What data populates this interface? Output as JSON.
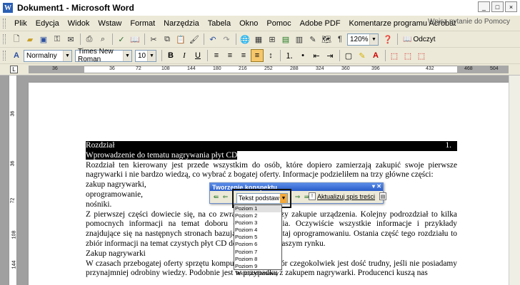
{
  "window": {
    "title": "Dokument1 - Microsoft Word",
    "app_icon": "W",
    "minimize": "_",
    "maximize": "□",
    "close": "×"
  },
  "menu": {
    "items": [
      "Plik",
      "Edycja",
      "Widok",
      "Wstaw",
      "Format",
      "Narzędzia",
      "Tabela",
      "Okno",
      "Pomoc",
      "Adobe PDF",
      "Komentarze programu Acrobat"
    ],
    "help_placeholder": "Wpisz pytanie do Pomocy"
  },
  "standard_toolbar": {
    "zoom": "120%",
    "read_button": "Odczyt"
  },
  "formatting_toolbar": {
    "style": "Normalny",
    "font": "Times New Roman",
    "size": "10",
    "bold": "B",
    "italic": "I",
    "underline": "U"
  },
  "ruler": {
    "tab_selector": "L",
    "h_numbers": [
      "36",
      "36",
      "72",
      "108",
      "144",
      "180",
      "216",
      "252",
      "288",
      "324",
      "360",
      "396",
      "432",
      "468",
      "504"
    ],
    "v_numbers": [
      "36",
      "36",
      "72",
      "108",
      "144"
    ]
  },
  "document": {
    "heading1": "Rozdział",
    "heading1_num": "1.",
    "heading2": "Wprowadzenie do tematu nagrywania płyt CD",
    "para1": "Rozdział ten kierowany jest przede wszystkim do osób, które dopiero zamierzają zakupić swoje pierwsze nagrywarki i nie bardzo wiedzą, co wybrać z bogatej oferty. Informacje podzieliłem na trzy główne części:",
    "list1": "zakup nagrywarki,",
    "list2": "oprogramowanie,",
    "list3": "nośniki.",
    "para2": "Z pierwszej części dowiecie się, na co zwracać uwagę przy zakupie urządzenia. Kolejny podrozdział to kilka pomocnych informacji na temat doboru oprogramowania. Oczywiście wszystkie informacje i przykłady znajdujące się na następnych stronach bazują właśnie na tutaj oprogramowaniu. Ostania część tego rozdziału to zbiór informacji na temat czystych płyt CD dostępnych na naszym rynku.",
    "heading3": "Zakup nagrywarki",
    "para3": "W czasach przebogatej oferty sprzętu komputerowego wybór czegokolwiek jest dość trudny, jeśli nie posiadamy przynajmniej odrobiny wiedzy. Podobnie jest w przypadku z zakupem nagrywarki. Producenci kuszą nas"
  },
  "outline_toolbar": {
    "title": "Tworzenie konspektu",
    "level_value": "Tekst podstaw",
    "update_toc": "Aktualizuj spis treści",
    "levels": [
      "Poziom 1",
      "Poziom 2",
      "Poziom 3",
      "Poziom 4",
      "Poziom 5",
      "Poziom 6",
      "Poziom 7",
      "Poziom 8",
      "Poziom 9",
      "Tekst podstawowy"
    ]
  }
}
